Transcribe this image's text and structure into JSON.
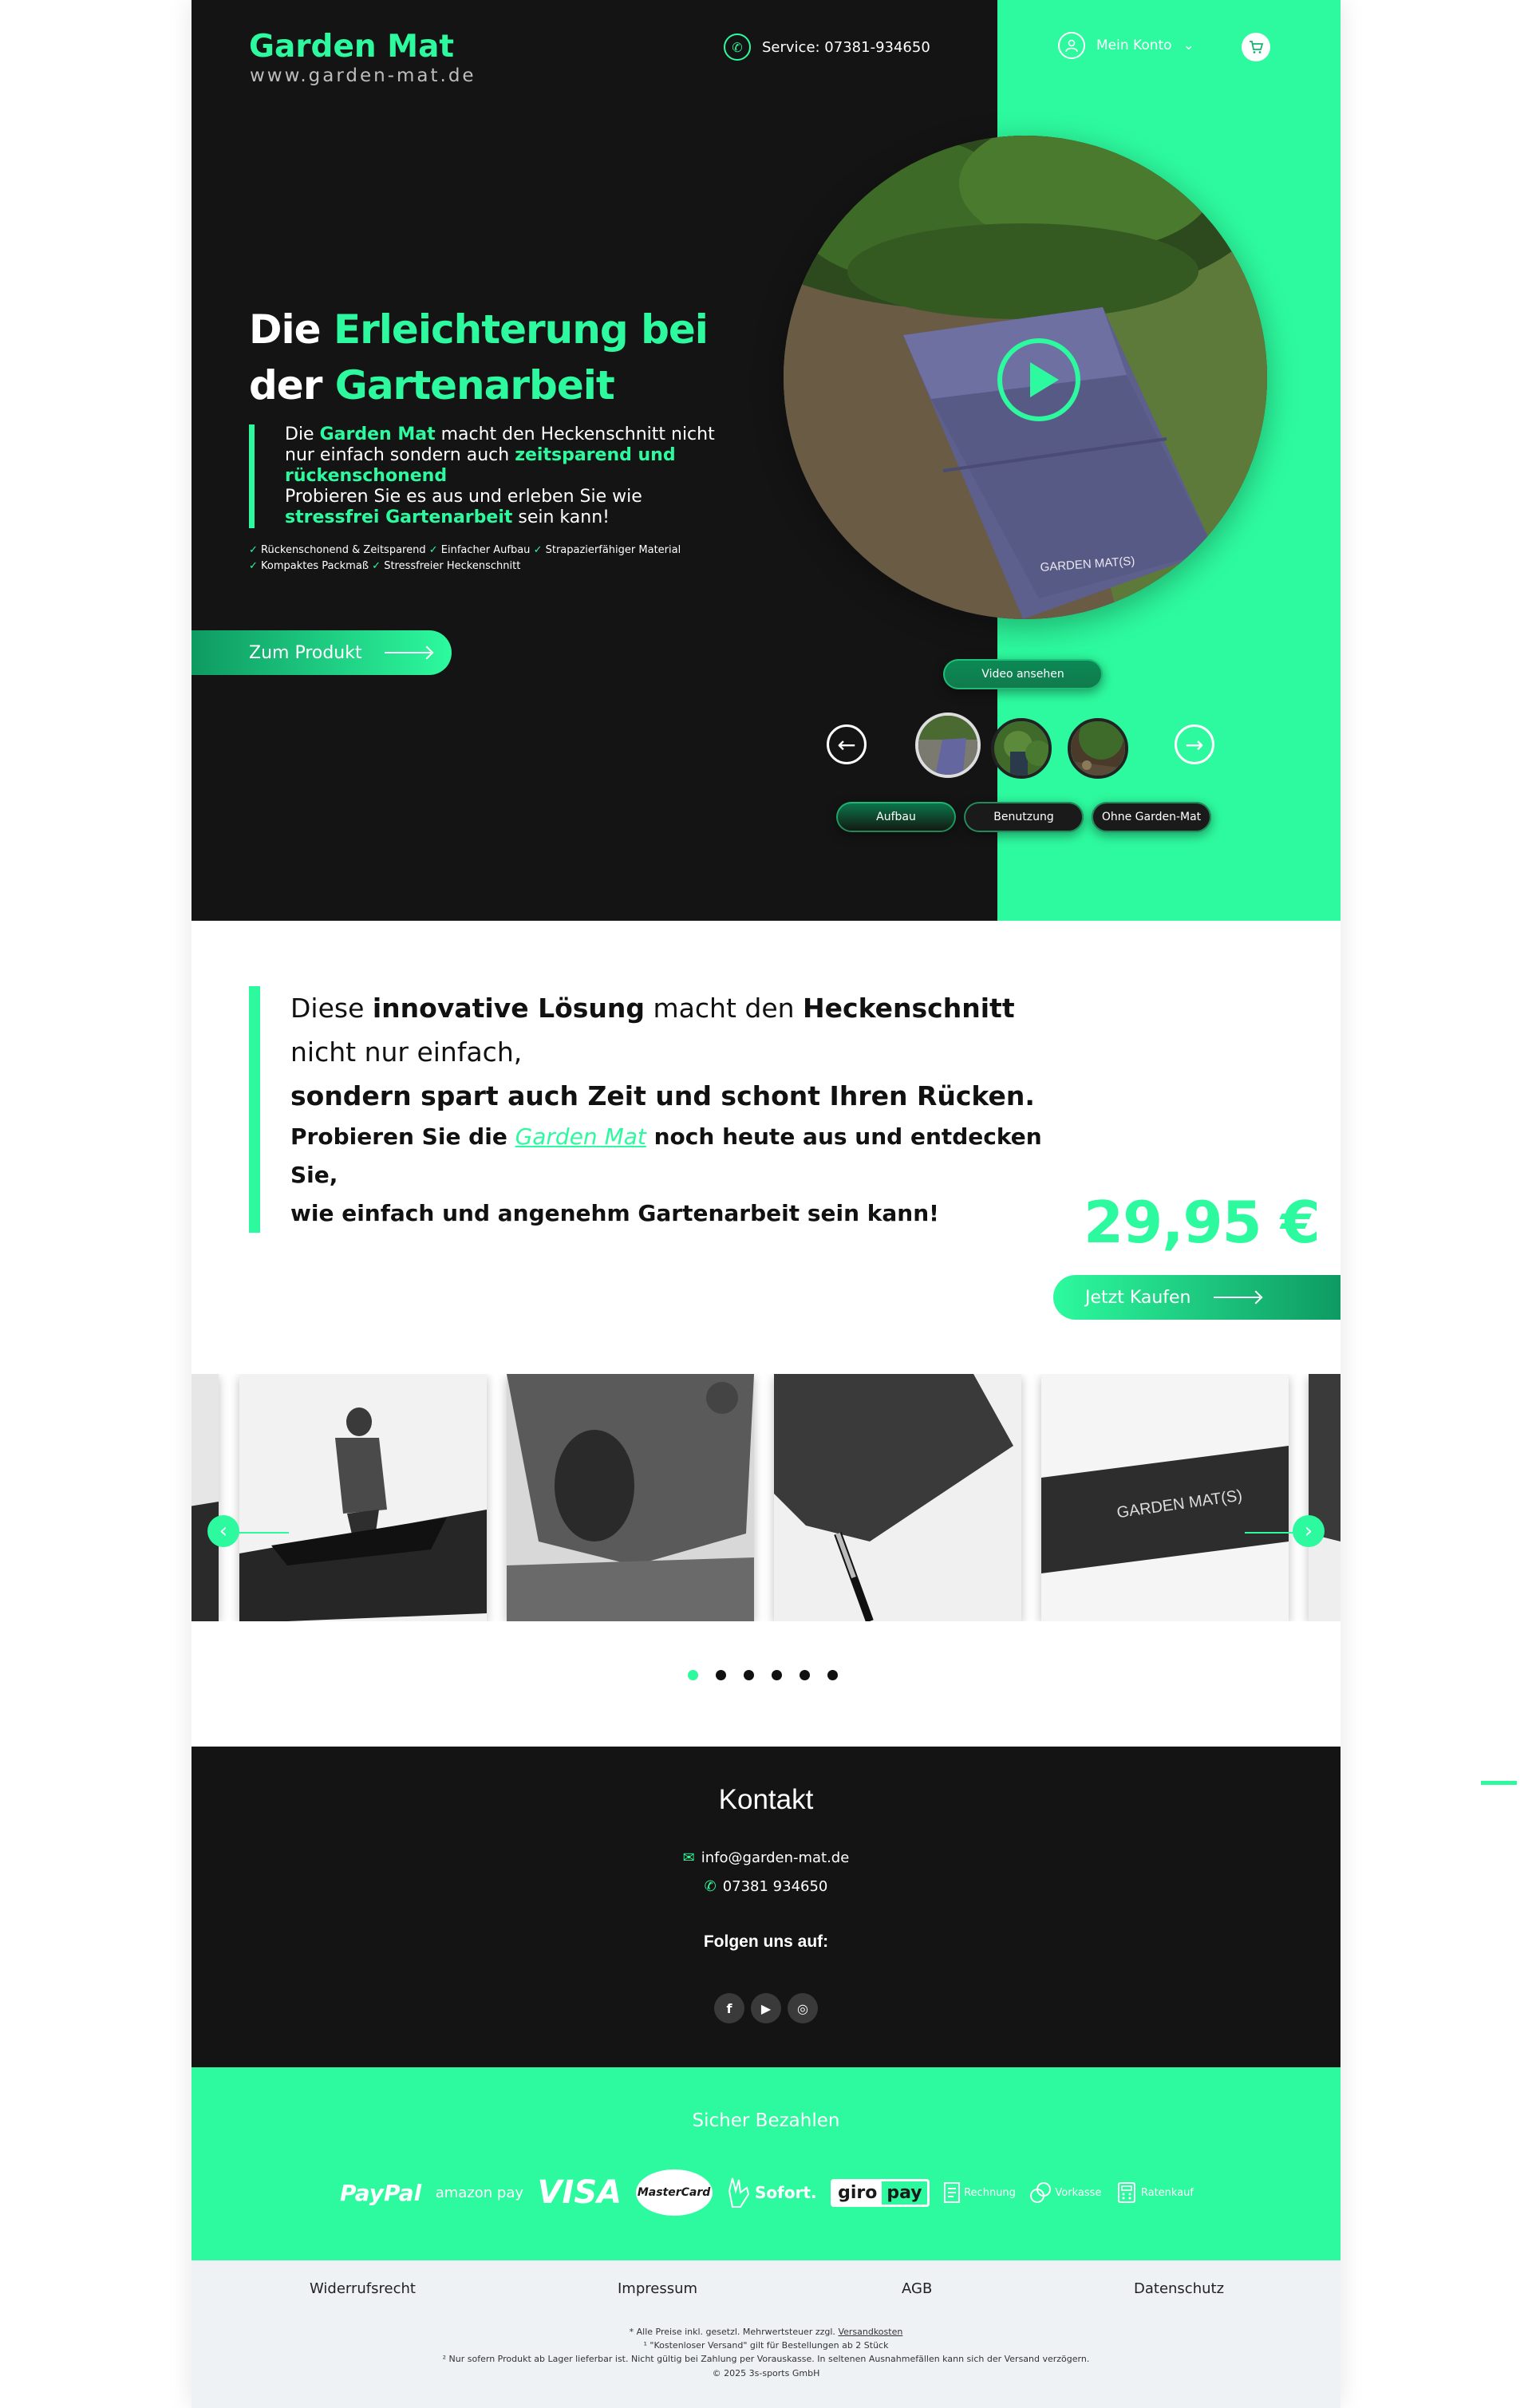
{
  "header": {
    "logo_title": "Garden Mat",
    "logo_sub": "www.garden-mat.de",
    "service": "Service: 07381-934650",
    "account": "Mein Konto",
    "account_chevron": "⌄"
  },
  "hero": {
    "headline_1_white": "Die ",
    "headline_1_green": "Erleichterung bei",
    "headline_2_white": "der ",
    "headline_2_green": "Gartenarbeit",
    "intro_1": "Die ",
    "intro_brand": "Garden Mat",
    "intro_2": " macht den Heckenschnitt nicht nur einfach sondern auch ",
    "intro_green_1": "zeitsparend und rückenschonend",
    "intro_3": "Probieren Sie es aus und erleben Sie wie ",
    "intro_green_2": "stressfrei Gartenarbeit",
    "intro_4": " sein kann!",
    "features": [
      "Rückenschonend & Zeitsparend",
      "Einfacher Aufbau",
      "Strapazierfähiger Material",
      "Kompaktes Packmaß",
      "Stressfreier Heckenschnitt"
    ],
    "check": "✓",
    "cta": "Zum Produkt",
    "video_button": "Video ansehen",
    "mat_print": "GARDEN MAT(S)",
    "tabs": [
      "Aufbau",
      "Benutzung",
      "Ohne Garden-Mat"
    ],
    "prev_arrow": "←",
    "next_arrow": "→"
  },
  "section2": {
    "q1_a": "Diese ",
    "q1_b": "innovative Lösung",
    "q1_c": " macht den ",
    "q1_d": "Heckenschnitt",
    "q1_e": " nicht nur einfach,",
    "q2": "sondern spart auch Zeit und schont Ihren Rücken.",
    "q3_a": "Probieren Sie die ",
    "q3_link": "Garden Mat",
    "q3_b": " noch heute aus und entdecken Sie,",
    "q4": "wie einfach und angenehm Gartenarbeit sein kann!",
    "price": "29,95 €",
    "buy": "Jetzt Kaufen",
    "slide_print": "GARDEN MAT(S)",
    "car_prev": "‹",
    "car_next": "›",
    "dots_count": 6,
    "active_dot": 0
  },
  "contact": {
    "title": "Kontakt",
    "email_icon": "✉",
    "email": "info@garden-mat.de",
    "phone_icon": "✆",
    "phone": "07381 934650",
    "follow": "Folgen uns auf:",
    "socials": [
      "f",
      "▶",
      "◎"
    ]
  },
  "payment": {
    "title": "Sicher Bezahlen",
    "paypal": "PayPal",
    "amazon": "amazon pay",
    "visa": "VISA",
    "mastercard": "MasterCard",
    "sofort": "Sofort.",
    "giro_1": "giro",
    "giro_2": "pay",
    "rechnung": "Rechnung",
    "vorkasse": "Vorkasse",
    "ratenkauf": "Ratenkauf"
  },
  "footer": {
    "links": [
      "Widerrufsrecht",
      "Impressum",
      "AGB",
      "Datenschutz"
    ],
    "fine1_a": "* Alle Preise inkl. gesetzl. Mehrwertsteuer zzgl. ",
    "fine1_link": "Versandkosten",
    "fine2": "¹ \"Kostenloser Versand\" gilt für Bestellungen ab 2 Stück",
    "fine3": "² Nur sofern Produkt ab Lager lieferbar ist. Nicht gültig bei Zahlung per Vorauskasse. In seltenen Ausnahmefällen kann sich der Versand verzögern.",
    "copyright": "© 2025 3s-sports GmbH"
  },
  "colors": {
    "accent": "#2dfa9e",
    "dark": "#141414",
    "footer_bg": "#eef2f4"
  }
}
